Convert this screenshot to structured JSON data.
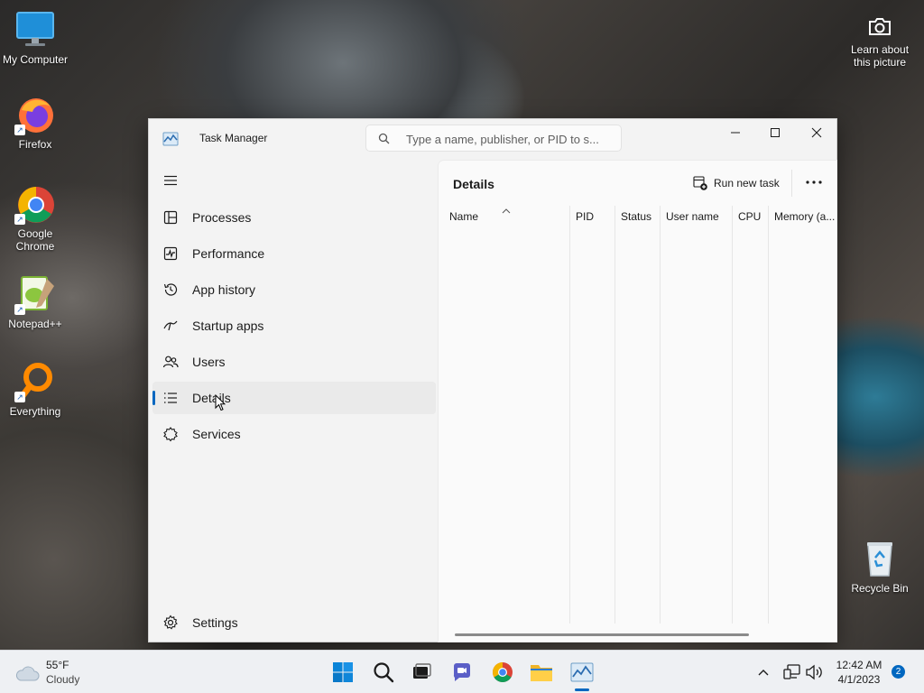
{
  "desktop": {
    "icons": [
      {
        "label": "My Computer",
        "icon": "monitor-icon"
      },
      {
        "label": "Firefox",
        "icon": "firefox-icon"
      },
      {
        "label": "Google Chrome",
        "icon": "chrome-icon"
      },
      {
        "label": "Notepad++",
        "icon": "notepadpp-icon"
      },
      {
        "label": "Everything",
        "icon": "everything-icon"
      },
      {
        "label": "Recycle Bin",
        "icon": "recycle-bin-icon"
      }
    ],
    "learn_about": "Learn about this picture"
  },
  "window": {
    "title": "Task Manager",
    "search_placeholder": "Type a name, publisher, or PID to s...",
    "nav": [
      {
        "label": "Processes",
        "icon": "processes-icon",
        "selected": false
      },
      {
        "label": "Performance",
        "icon": "performance-icon",
        "selected": false
      },
      {
        "label": "App history",
        "icon": "app-history-icon",
        "selected": false
      },
      {
        "label": "Startup apps",
        "icon": "startup-apps-icon",
        "selected": false
      },
      {
        "label": "Users",
        "icon": "users-icon",
        "selected": false
      },
      {
        "label": "Details",
        "icon": "details-icon",
        "selected": true
      },
      {
        "label": "Services",
        "icon": "services-icon",
        "selected": false
      }
    ],
    "settings_label": "Settings",
    "content": {
      "title": "Details",
      "run_new_task": "Run new task",
      "columns": [
        "Name",
        "PID",
        "Status",
        "User name",
        "CPU",
        "Memory (a..."
      ]
    }
  },
  "taskbar": {
    "weather_temp": "55°F",
    "weather_cond": "Cloudy",
    "time": "12:42 AM",
    "date": "4/1/2023",
    "notification_count": "2",
    "accent": "#0067c0"
  }
}
